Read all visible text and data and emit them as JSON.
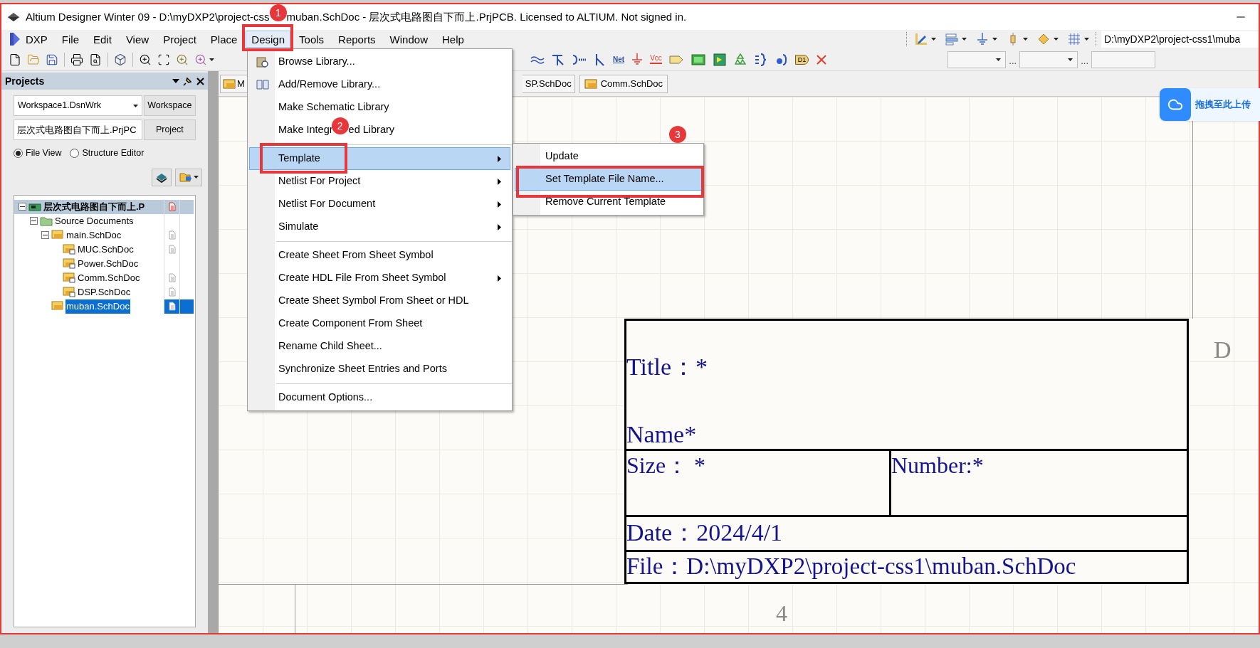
{
  "window": {
    "title_before_badge": "Altium Designer Winter 09 - D:\\myDXP2\\project-css",
    "title_after_badge": "muban.SchDoc - 层次式电路图自下而上.PrjPCB. Licensed to ALTIUM. Not signed in."
  },
  "badges": [
    "1",
    "2",
    "3"
  ],
  "menu_bar": [
    {
      "label": "DXP",
      "selected": false
    },
    {
      "label": "File",
      "selected": false
    },
    {
      "label": "Edit",
      "selected": false
    },
    {
      "label": "View",
      "selected": false
    },
    {
      "label": "Project",
      "selected": false
    },
    {
      "label": "Place",
      "selected": false
    },
    {
      "label": "Design",
      "selected": true
    },
    {
      "label": "Tools",
      "selected": false
    },
    {
      "label": "Reports",
      "selected": false
    },
    {
      "label": "Window",
      "selected": false
    },
    {
      "label": "Help",
      "selected": false
    }
  ],
  "path_field": "D:\\myDXP2\\project-css1\\muba",
  "toolbar_icon_labels": {
    "net": "Net",
    "power": "Vcc",
    "part": "D1"
  },
  "combo_separators": [
    "...",
    "..."
  ],
  "upload_widget": {
    "label": "拖拽至此上传"
  },
  "projects_panel": {
    "title": "Projects",
    "workspace": "Workspace1.DsnWrk",
    "workspace_button": "Workspace",
    "project": "层次式电路图自下而上.PrjPC",
    "project_button": "Project",
    "view_options": [
      {
        "label": "File View",
        "selected": true
      },
      {
        "label": "Structure Editor",
        "selected": false
      }
    ],
    "tree": [
      {
        "label": "层次式电路图自下而上.P",
        "kind": "project",
        "expanded": true,
        "selected": false,
        "doc_icon": true,
        "children": [
          {
            "label": "Source Documents",
            "kind": "folder",
            "expanded": true,
            "selected": false,
            "doc_icon": false,
            "children": [
              {
                "label": "main.SchDoc",
                "kind": "sheet",
                "expanded": true,
                "selected": false,
                "doc_icon": true,
                "children": [
                  {
                    "label": "MUC.SchDoc",
                    "kind": "child",
                    "selected": false,
                    "doc_icon": true
                  },
                  {
                    "label": "Power.SchDoc",
                    "kind": "child",
                    "selected": false,
                    "doc_icon": false
                  },
                  {
                    "label": "Comm.SchDoc",
                    "kind": "child",
                    "selected": false,
                    "doc_icon": true
                  },
                  {
                    "label": "DSP.SchDoc",
                    "kind": "child",
                    "selected": false,
                    "doc_icon": true
                  }
                ]
              },
              {
                "label": "muban.SchDoc",
                "kind": "sheet",
                "selected": true,
                "doc_icon": true
              }
            ]
          }
        ]
      }
    ]
  },
  "doc_tabs": [
    {
      "label": "M"
    },
    {
      "label": "SP.SchDoc"
    },
    {
      "label": "Comm.SchDoc"
    }
  ],
  "design_menu": [
    {
      "kind": "item",
      "label": "Browse Library...",
      "submenu": false,
      "selected": false
    },
    {
      "kind": "item",
      "label": "Add/Remove Library...",
      "submenu": false,
      "selected": false
    },
    {
      "kind": "item",
      "label": "Make Schematic Library",
      "submenu": false,
      "selected": false
    },
    {
      "kind": "item",
      "label": "Make Integr",
      "label_after_badge": "ed Library",
      "submenu": false,
      "selected": false
    },
    {
      "kind": "separator"
    },
    {
      "kind": "item",
      "label": "Template",
      "submenu": true,
      "selected": true
    },
    {
      "kind": "item",
      "label": "Netlist For Project",
      "submenu": true,
      "selected": false
    },
    {
      "kind": "item",
      "label": "Netlist For Document",
      "submenu": true,
      "selected": false
    },
    {
      "kind": "item",
      "label": "Simulate",
      "submenu": true,
      "selected": false
    },
    {
      "kind": "separator"
    },
    {
      "kind": "item",
      "label": "Create Sheet From Sheet Symbol",
      "submenu": false,
      "selected": false
    },
    {
      "kind": "item",
      "label": "Create HDL File From Sheet Symbol",
      "submenu": true,
      "selected": false
    },
    {
      "kind": "item",
      "label": "Create Sheet Symbol From Sheet or HDL",
      "submenu": false,
      "selected": false
    },
    {
      "kind": "item",
      "label": "Create Component From Sheet",
      "submenu": false,
      "selected": false
    },
    {
      "kind": "item",
      "label": "Rename Child Sheet...",
      "submenu": false,
      "selected": false
    },
    {
      "kind": "item",
      "label": "Synchronize Sheet Entries and Ports",
      "submenu": false,
      "selected": false
    },
    {
      "kind": "separator"
    },
    {
      "kind": "item",
      "label": "Document Options...",
      "submenu": false,
      "selected": false
    }
  ],
  "template_submenu": [
    {
      "label": "Update",
      "selected": false
    },
    {
      "label": "Set Template File Name...",
      "selected": true
    },
    {
      "label": "Remove Current Template",
      "selected": false
    }
  ],
  "title_block": {
    "title": "Title：*",
    "name": "Name*",
    "size": "Size： *",
    "number": "Number:*",
    "date": "Date：2024/4/1",
    "file": "File：D:\\myDXP2\\project-css1\\muban.SchDoc"
  },
  "zone_labels": {
    "row": "D",
    "column": "4"
  }
}
